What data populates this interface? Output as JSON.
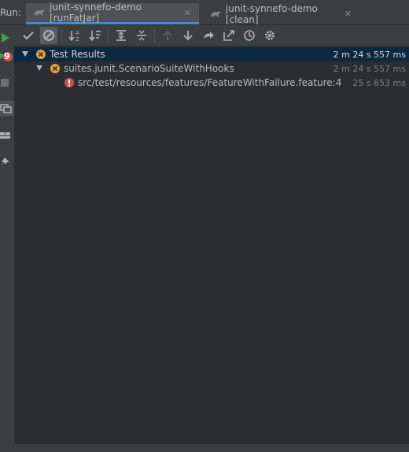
{
  "run_label": "Run:",
  "tabs": [
    {
      "label": "junit-synnefo-demo [runFatJar]",
      "active": true
    },
    {
      "label": "junit-synnefo-demo [clean]",
      "active": false
    }
  ],
  "tab_close_glyph": "✕",
  "left_badge": "9",
  "tree": {
    "root": {
      "label": "Test Results",
      "time": "2 m 24 s 557 ms"
    },
    "suite": {
      "label": "suites.junit.ScenarioSuiteWithHooks",
      "time": "2 m 24 s 557 ms"
    },
    "test": {
      "label": "src/test/resources/features/FeatureWithFailure.feature:4",
      "time": "25 s 653 ms"
    }
  },
  "colors": {
    "accent": "#4a88c7",
    "run_green": "#499c54",
    "error_red": "#c75450",
    "warning_orange": "#e5a03f",
    "selection": "#0d293e"
  },
  "icons": [
    "rerun-icon",
    "show-passed-icon",
    "show-ignored-icon",
    "sort-alpha-icon",
    "sort-duration-icon",
    "expand-all-icon",
    "collapse-all-icon",
    "prev-failed-icon",
    "next-failed-icon",
    "import-tests-icon",
    "export-icon",
    "history-icon",
    "settings-icon"
  ]
}
